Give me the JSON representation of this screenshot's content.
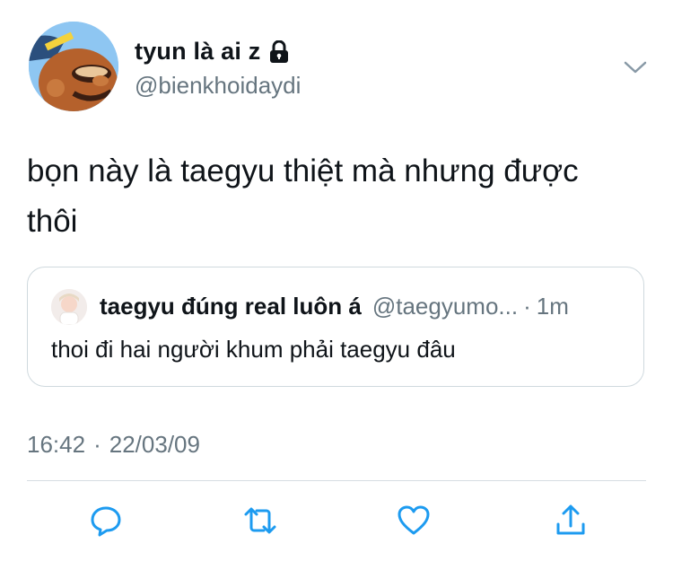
{
  "author": {
    "display_name": "tyun là ai z",
    "handle": "@bienkhoidaydi",
    "avatar_icon": "cartoon-fish-avatar",
    "protected_icon": "lock-icon"
  },
  "tweet": {
    "text": "bọn này là taegyu thiệt mà nhưng được thôi",
    "timestamp_time": "16:42",
    "timestamp_sep": "·",
    "timestamp_date": "22/03/09"
  },
  "quoted_tweet": {
    "display_name": "taegyu đúng real luôn á",
    "handle": "@taegyumo...",
    "dot": "·",
    "time": "1m",
    "text": "thoi đi hai người khum phải taegyu đâu",
    "avatar_icon": "person-photo-avatar"
  },
  "actions": {
    "reply_icon": "reply-icon",
    "retweet_icon": "retweet-icon",
    "like_icon": "heart-icon",
    "share_icon": "share-icon"
  },
  "colors": {
    "text_primary": "#0f1419",
    "text_secondary": "#66757f",
    "border": "#cfd9de",
    "icon": "#1d9bf0"
  }
}
